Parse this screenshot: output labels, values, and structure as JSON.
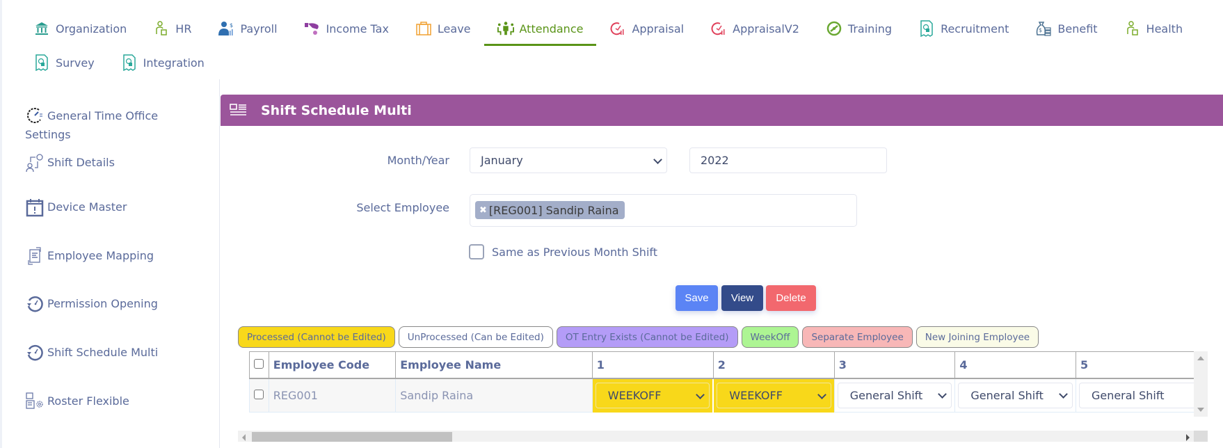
{
  "topnav": {
    "items": [
      {
        "label": "Organization",
        "icon": "bank-icon",
        "color": "#2a9d8f"
      },
      {
        "label": "HR",
        "icon": "person-badge-icon",
        "color": "#7aab2a"
      },
      {
        "label": "Payroll",
        "icon": "payroll-person-icon",
        "color": "#2f6fb0"
      },
      {
        "label": "Income Tax",
        "icon": "hand-coin-icon",
        "color": "#8e3ea0"
      },
      {
        "label": "Leave",
        "icon": "suitcase-icon",
        "color": "#f0a030"
      },
      {
        "label": "Attendance",
        "icon": "meeting-icon",
        "color": "#5a9418"
      },
      {
        "label": "Appraisal",
        "icon": "clock-chart-icon",
        "color": "#e0405a"
      },
      {
        "label": "AppraisalV2",
        "icon": "clock-chart-icon",
        "color": "#e0405a"
      },
      {
        "label": "Training",
        "icon": "training-clock-icon",
        "color": "#6aa832"
      },
      {
        "label": "Recruitment",
        "icon": "document-person-icon",
        "color": "#2aa89a"
      },
      {
        "label": "Benefit",
        "icon": "money-bag-icon",
        "color": "#4a7090"
      },
      {
        "label": "Health",
        "icon": "person-badge-icon",
        "color": "#7aab2a"
      },
      {
        "label": "Survey",
        "icon": "document-person-icon",
        "color": "#2aa89a"
      },
      {
        "label": "Integration",
        "icon": "document-person-icon",
        "color": "#2aa89a"
      }
    ],
    "active": "Attendance"
  },
  "sidebar": {
    "items": [
      {
        "label_line1": "General Time Office",
        "label_line2": "Settings",
        "icon": "gear-clock-icon"
      },
      {
        "label": "Shift Details",
        "icon": "user-swap-icon"
      },
      {
        "label": "Device Master",
        "icon": "calendar-alert-icon"
      },
      {
        "label": "Employee Mapping",
        "icon": "document-map-icon"
      },
      {
        "label": "Permission Opening",
        "icon": "clock-history-icon"
      },
      {
        "label": "Shift Schedule Multi",
        "icon": "clock-history-icon"
      },
      {
        "label": "Roster Flexible",
        "icon": "roster-gear-icon"
      }
    ]
  },
  "panel": {
    "title": "Shift Schedule Multi",
    "header_color": "#9b559b",
    "form": {
      "month_year_label": "Month/Year",
      "month_value": "January",
      "year_value": "2022",
      "select_employee_label": "Select Employee",
      "selected_employee_tag": "[REG001] Sandip Raina",
      "same_as_prev_label": "Same as Previous Month Shift",
      "same_as_prev_checked": false
    },
    "buttons": {
      "save": "Save",
      "view": "View",
      "delete": "Delete",
      "save_color": "#5b84f5",
      "view_color": "#334b8a",
      "delete_color": "#f2686e"
    },
    "legend": [
      {
        "label": "Processed (Cannot be Edited)",
        "color": "#f8d81a"
      },
      {
        "label": "UnProcessed (Can be Edited)",
        "color": "#ffffff"
      },
      {
        "label": "OT Entry Exists (Cannot be Edited)",
        "color": "#b49cf7"
      },
      {
        "label": "WeekOff",
        "color": "#adf593"
      },
      {
        "label": "Separate Employee",
        "color": "#f8b7b7"
      },
      {
        "label": "New Joining Employee",
        "color": "#fafbe7"
      }
    ],
    "table": {
      "headers": [
        "Employee Code",
        "Employee Name",
        "1",
        "2",
        "3",
        "4",
        "5"
      ],
      "rows": [
        {
          "code": "REG001",
          "name": "Sandip Raina",
          "days": [
            {
              "value": "WEEKOFF",
              "status": "processed"
            },
            {
              "value": "WEEKOFF",
              "status": "processed"
            },
            {
              "value": "General Shift",
              "status": "unprocessed"
            },
            {
              "value": "General Shift",
              "status": "unprocessed"
            },
            {
              "value": "General Shift",
              "status": "unprocessed"
            }
          ]
        }
      ]
    }
  }
}
